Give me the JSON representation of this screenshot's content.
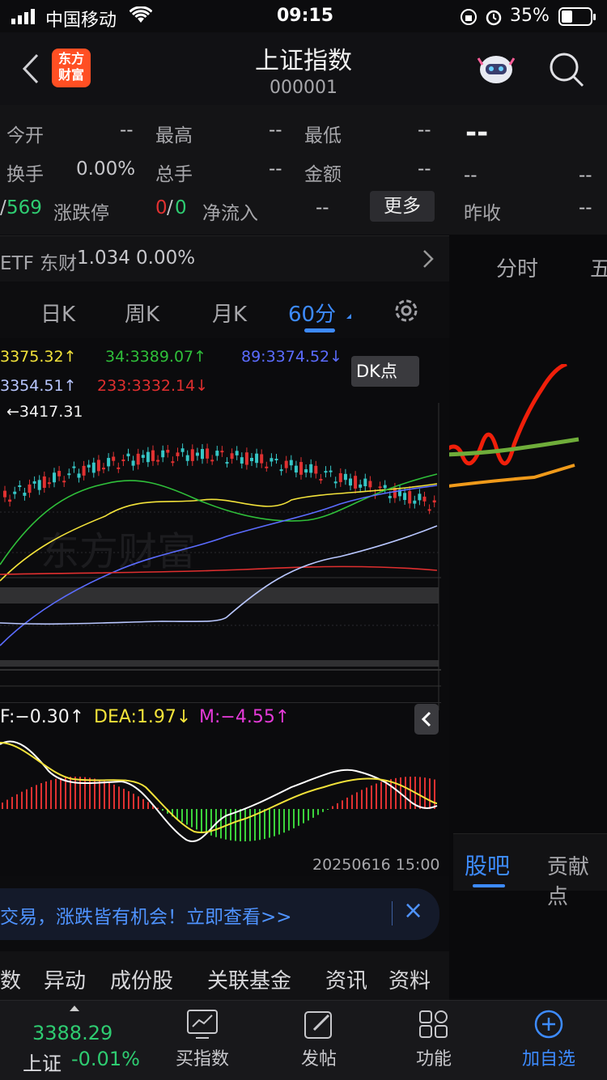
{
  "status_bar": {
    "carrier": "中国移动",
    "time": "09:15",
    "battery": "35%"
  },
  "header": {
    "title": "上证指数",
    "code": "000001",
    "logo_line1": "东方",
    "logo_line2": "财富"
  },
  "quote": {
    "open_label": "今开",
    "open_val": "--",
    "high_label": "最高",
    "high_val": "--",
    "low_label": "最低",
    "low_val": "--",
    "turnover_label": "换手",
    "turnover_val": "0.00%",
    "volume_label": "总手",
    "volume_val": "--",
    "amount_label": "金额",
    "amount_val": "--",
    "updown_prefix": "/",
    "updown_down": "569",
    "limit_label": "涨跌停",
    "limit_up": "0",
    "limit_slash": "/",
    "limit_down": "0",
    "netflow_label": "净流入",
    "netflow_val": "--",
    "more_button": "更多"
  },
  "right_panel": {
    "price": "--",
    "v1": "--",
    "v2": "--",
    "prev_close_label": "昨收",
    "prev_close_val": "--",
    "tab_minute": "分时",
    "tab_five": "五",
    "tab_guba": "股吧",
    "tab_contrib": "贡献点"
  },
  "etf": {
    "name": "ETF 东财",
    "price": "1.034",
    "change": "0.00%"
  },
  "kline_tabs": {
    "day": "日K",
    "week": "周K",
    "month": "月K",
    "min60": "60分"
  },
  "ma_legend": {
    "ma_a": "3375.32↑",
    "ma34": "34:3389.07↑",
    "ma89": "89:3374.52↓",
    "ma_b": "3354.51↑",
    "ma233": "233:3332.14↓",
    "dk": "DK点"
  },
  "chart_data": {
    "type": "candlestick",
    "annotation": "←3417.31",
    "macd_legend": {
      "dif": "F:−0.30↑",
      "dea": "DEA:1.97↓",
      "m": "M:−4.55↑"
    },
    "timestamp": "20250616 15:00"
  },
  "promo": {
    "text": "交易，涨跌皆有机会！立即查看>>",
    "close": "×"
  },
  "sub_tabs": [
    "数",
    "异动",
    "成份股",
    "关联基金",
    "资讯",
    "资料"
  ],
  "bottom_bar": {
    "price": "3388.29",
    "name": "上证",
    "change": "-0.01%",
    "buy": "买指数",
    "post": "发帖",
    "func": "功能",
    "add": "加自选"
  },
  "colors": {
    "up": "#e03131",
    "down": "#2ecc71",
    "accent": "#3d8bff",
    "ma_yellow": "#f2e23a",
    "ma_green": "#2fbf3a",
    "ma_blue": "#5b6cff",
    "ma_red": "#e02f2f",
    "ma_light": "#b9c7ff"
  }
}
